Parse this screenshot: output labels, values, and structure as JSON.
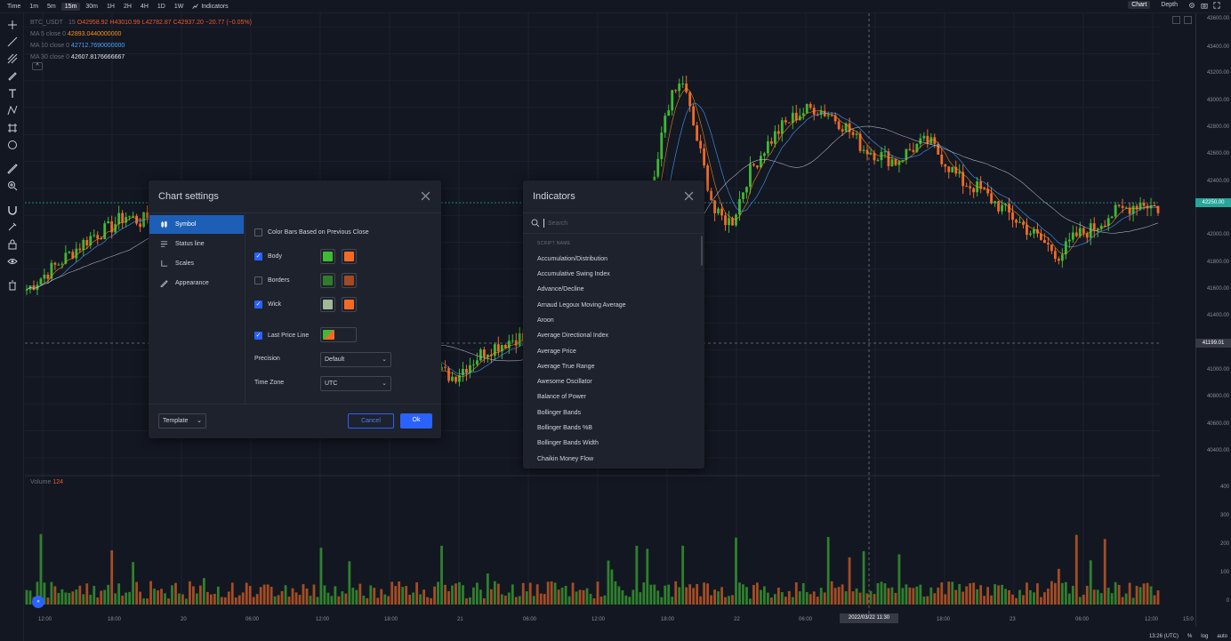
{
  "topbar": {
    "intervals": [
      "Time",
      "1m",
      "5m",
      "15m",
      "30m",
      "1H",
      "2H",
      "4H",
      "1D",
      "1W"
    ],
    "active_interval": "15m",
    "indicators_label": "Indicators",
    "chart_label": "Chart",
    "depth_label": "Depth"
  },
  "legend": {
    "symbol": "BTC_USDT · 15",
    "ohlc": "O42958.92 H43010.99 L42782.87 C42937.20 −20.77 (−0.05%)",
    "ma5_label": "MA 5 close 0",
    "ma5_value": "42893.0440000000",
    "ma10_label": "MA 10 close 0",
    "ma10_value": "42712.7690000000",
    "ma30_label": "MA 30 close 0",
    "ma30_value": "42607.8176666667",
    "collapse_glyph": "^"
  },
  "price_scale": {
    "labels": [
      "43600.00",
      "43400.00",
      "43200.00",
      "43000.00",
      "42800.00",
      "42600.00",
      "42400.00",
      "42000.00",
      "41800.00",
      "41600.00",
      "41400.00",
      "41000.00",
      "40800.00",
      "40600.00",
      "40400.00"
    ],
    "last_price": "42250.00",
    "cross_price": "41199.01",
    "last_price_color": "#26a69a",
    "volume_labels": [
      "400",
      "300",
      "200",
      "100",
      "0"
    ]
  },
  "time_axis": {
    "labels": [
      "12:00",
      "18:00",
      "20",
      "06:00",
      "12:00",
      "18:00",
      "21",
      "06:00",
      "12:00",
      "18:00",
      "22",
      "06:00",
      "12:00",
      "18:00",
      "23",
      "06:00",
      "12:00",
      "15:0"
    ],
    "cross_time": "2022/03/22   11:30",
    "clock": "13:26 (UTC)",
    "percent_label": "%",
    "log_label": "log",
    "auto_label": "auto"
  },
  "volume": {
    "label": "Volume",
    "value": "124"
  },
  "chart_settings": {
    "title": "Chart settings",
    "nav": [
      "Symbol",
      "Status line",
      "Scales",
      "Appearance"
    ],
    "active_nav": "Symbol",
    "color_bars_label": "Color Bars Based on Previous Close",
    "body_label": "Body",
    "borders_label": "Borders",
    "wick_label": "Wick",
    "last_price_line_label": "Last Price Line",
    "precision_label": "Precision",
    "precision_value": "Default",
    "timezone_label": "Time Zone",
    "timezone_value": "UTC",
    "template_label": "Template",
    "cancel_label": "Cancel",
    "ok_label": "Ok",
    "colors": {
      "up": "#3fba33",
      "down": "#f46a25",
      "border_up": "#2f7d2a",
      "border_down": "#a44a22"
    }
  },
  "indicators": {
    "title": "Indicators",
    "search_placeholder": "Search",
    "column_header": "SCRIPT NAME",
    "items": [
      "Accumulation/Distribution",
      "Accumulative Swing Index",
      "Advance/Decline",
      "Arnaud Legoux Moving Average",
      "Aroon",
      "Average Directional Index",
      "Average Price",
      "Average True Range",
      "Awesome Oscillator",
      "Balance of Power",
      "Bollinger Bands",
      "Bollinger Bands %B",
      "Bollinger Bands Width",
      "Chaikin Money Flow"
    ]
  },
  "chart_data": {
    "type": "candlestick",
    "title": "",
    "xlabel": "",
    "ylabel": "",
    "ylim": [
      40300,
      43700
    ],
    "grid": true,
    "series": [
      {
        "name": "Candles",
        "close": [
          41650,
          41750,
          41850,
          41950,
          42050,
          42100,
          42200,
          42150,
          42250,
          42300,
          42350,
          42400,
          42300,
          41900,
          41450,
          41200,
          41000,
          40750,
          40900,
          41100,
          41300,
          41400,
          41350,
          41250,
          41150,
          41050,
          41000,
          41100,
          41200,
          41250,
          41300,
          41200,
          41100,
          41150,
          41050,
          41000,
          41200,
          41600,
          42200,
          43000,
          43200,
          42700,
          42200,
          42150,
          42500,
          42700,
          42850,
          42950,
          43000,
          42950,
          42850,
          42700,
          42650,
          42600,
          42700,
          42750,
          42600,
          42450,
          42400,
          42300,
          42200,
          42100,
          42000,
          41900,
          42050,
          42100,
          42200,
          42250,
          42300,
          42250
        ]
      }
    ]
  }
}
